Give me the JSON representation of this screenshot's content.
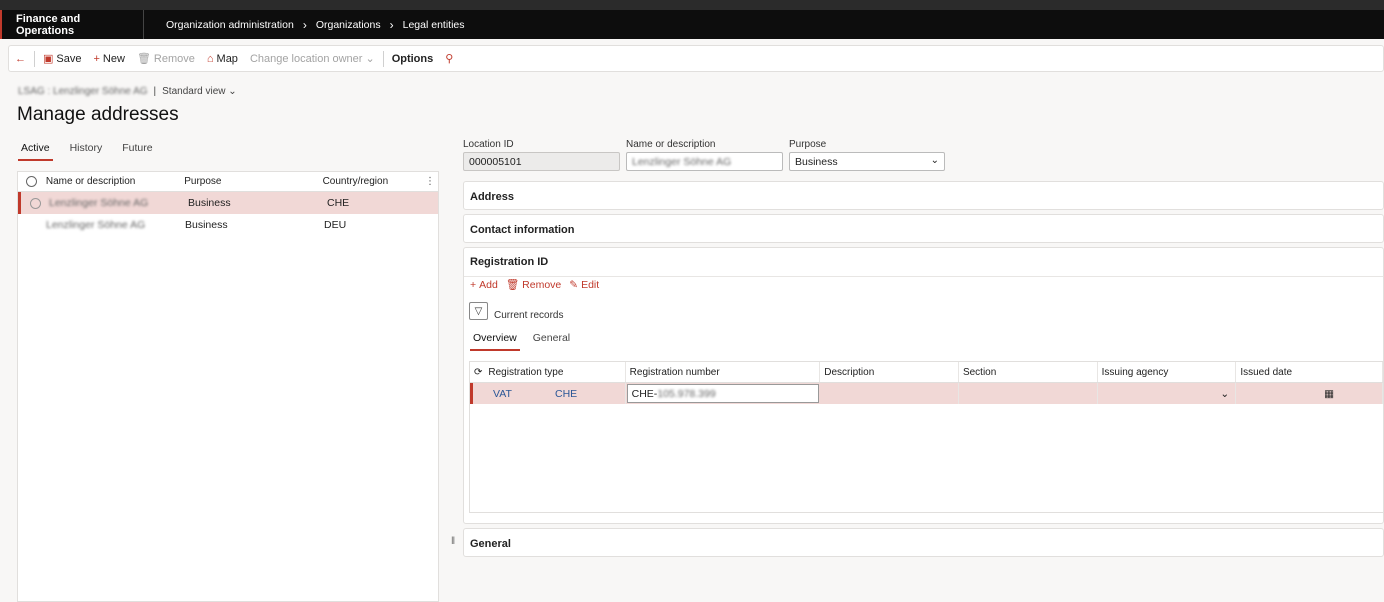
{
  "nav": {
    "app_title": "Finance and Operations",
    "breadcrumbs": [
      "Organization administration",
      "Organizations",
      "Legal entities"
    ]
  },
  "actions": {
    "save": "Save",
    "new": "New",
    "remove": "Remove",
    "map": "Map",
    "change_owner": "Change location owner",
    "options": "Options"
  },
  "header": {
    "entity": "LSAG : Lenzlinger Söhne AG",
    "view": "Standard view",
    "title": "Manage addresses"
  },
  "tabs": [
    "Active",
    "History",
    "Future"
  ],
  "address_list": {
    "columns": [
      "Name or description",
      "Purpose",
      "Country/region"
    ],
    "rows": [
      {
        "name": "Lenzlinger Söhne AG",
        "purpose": "Business",
        "country": "CHE"
      },
      {
        "name": "Lenzlinger Söhne AG",
        "purpose": "Business",
        "country": "DEU"
      }
    ]
  },
  "details": {
    "location_id_label": "Location ID",
    "location_id": "000005101",
    "name_label": "Name or description",
    "name": "Lenzlinger Söhne AG",
    "purpose_label": "Purpose",
    "purpose": "Business"
  },
  "sections": {
    "address": "Address",
    "contact": "Contact information",
    "registration": "Registration ID",
    "general": "General"
  },
  "registration": {
    "add": "Add",
    "remove": "Remove",
    "edit": "Edit",
    "filter_label": "Current records",
    "subtabs": [
      "Overview",
      "General"
    ],
    "columns": [
      "Registration type",
      "Registration number",
      "Description",
      "Section",
      "Issuing agency",
      "Issued date"
    ],
    "row": {
      "type": "VAT",
      "country": "CHE",
      "number_prefix": "CHE-",
      "number_rest": "105.978.399"
    }
  },
  "colors": {
    "accent": "#c0392b",
    "selected_row": "#f1d8d6",
    "link": "#2b5797"
  }
}
